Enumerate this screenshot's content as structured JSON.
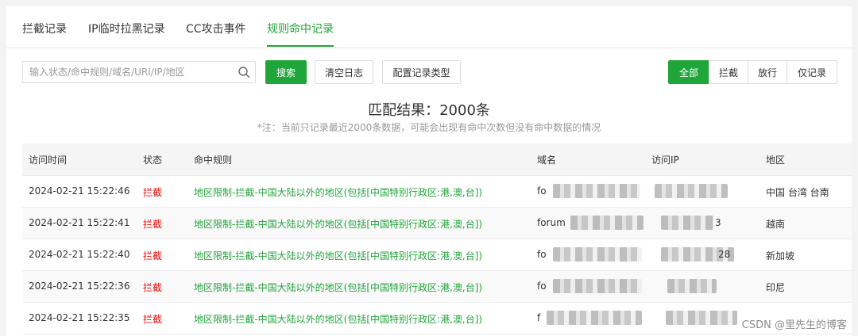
{
  "tabs": [
    {
      "label": "拦截记录"
    },
    {
      "label": "IP临时拉黑记录"
    },
    {
      "label": "CC攻击事件"
    },
    {
      "label": "规则命中记录"
    }
  ],
  "active_tab": "规则命中记录",
  "search": {
    "placeholder": "输入状态/命中规则/域名/URI/IP/地区",
    "value": ""
  },
  "toolbar": {
    "search_button": "搜索",
    "clear_log_button": "清空日志",
    "config_type_button": "配置记录类型"
  },
  "filters": [
    {
      "label": "全部"
    },
    {
      "label": "拦截"
    },
    {
      "label": "放行"
    },
    {
      "label": "仅记录"
    }
  ],
  "active_filter": "全部",
  "summary": {
    "title": "匹配结果：2000条",
    "note": "*注：当前只记录最近2000条数据，可能会出现有命中次数但没有命中数据的情况"
  },
  "table": {
    "headers": [
      "访问时间",
      "状态",
      "命中规则",
      "域名",
      "访问IP",
      "地区"
    ],
    "rows": [
      {
        "time": "2024-02-21 15:22:46",
        "status": "拦截",
        "rule": "地区限制-拦截-中国大陆以外的地区(包括[中国特别行政区:港,澳,台])",
        "domain": "fo",
        "ip": "",
        "region": "中国 台湾 台南"
      },
      {
        "time": "2024-02-21 15:22:41",
        "status": "拦截",
        "rule": "地区限制-拦截-中国大陆以外的地区(包括[中国特别行政区:港,澳,台])",
        "domain": "forum",
        "ip": "3",
        "region": "越南"
      },
      {
        "time": "2024-02-21 15:22:40",
        "status": "拦截",
        "rule": "地区限制-拦截-中国大陆以外的地区(包括[中国特别行政区:港,澳,台])",
        "domain": "fo",
        "ip": "28",
        "region": "新加坡"
      },
      {
        "time": "2024-02-21 15:22:36",
        "status": "拦截",
        "rule": "地区限制-拦截-中国大陆以外的地区(包括[中国特别行政区:港,澳,台])",
        "domain": "fo",
        "ip": "",
        "region": "印尼"
      },
      {
        "time": "2024-02-21 15:22:35",
        "status": "拦截",
        "rule": "地区限制-拦截-中国大陆以外的地区(包括[中国特别行政区:港,澳,台])",
        "domain": "f",
        "ip": "",
        "region": ""
      }
    ]
  },
  "watermark": "CSDN @里先生的博客",
  "colors": {
    "accent": "#20a53a",
    "danger": "#ef0808"
  }
}
